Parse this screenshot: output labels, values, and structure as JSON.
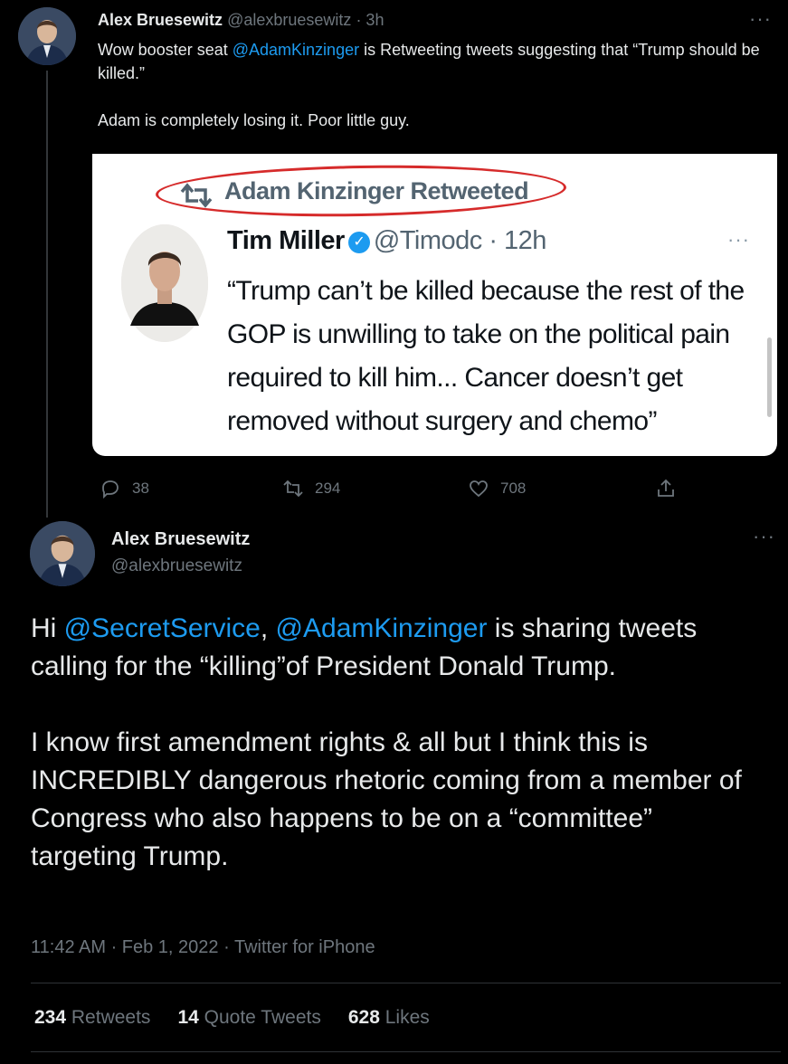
{
  "tweet1": {
    "name": "Alex Bruesewitz",
    "handle": "@alexbruesewitz",
    "time": "· 3h",
    "more": "···",
    "text_before": "Wow booster seat ",
    "mention": "@AdamKinzinger",
    "text_after": " is Retweeting tweets suggesting that “Trump should be killed.”",
    "text2": "Adam is completely losing it. Poor little guy.",
    "embed": {
      "retweet_label": "Adam Kinzinger Retweeted",
      "name": "Tim Miller",
      "handle_time": "@Timodc · 12h",
      "more": "···",
      "text": "“Trump can’t be killed because the rest of the GOP is unwilling to take on the political pain required to kill him... Cancer doesn’t get removed without surgery and chemo”"
    },
    "actions": {
      "replies": "38",
      "retweets": "294",
      "likes": "708"
    }
  },
  "tweet2": {
    "name": "Alex Bruesewitz",
    "handle": "@alexbruesewitz",
    "more": "···",
    "p1_hi": "Hi ",
    "p1_mention1": "@SecretService",
    "p1_comma": ", ",
    "p1_mention2": "@AdamKinzinger",
    "p1_rest": " is sharing tweets calling for the “killing”of President Donald Trump.",
    "p2": "I know first amendment rights & all but I think this is INCREDIBLY dangerous rhetoric coming from a member of Congress who also happens to be on a “committee” targeting Trump.",
    "meta": "11:42 AM · Feb 1, 2022 · Twitter for iPhone",
    "stats": {
      "retweets_count": "234",
      "retweets_label": "Retweets",
      "quotes_count": "14",
      "quotes_label": "Quote Tweets",
      "likes_count": "628",
      "likes_label": "Likes"
    }
  }
}
